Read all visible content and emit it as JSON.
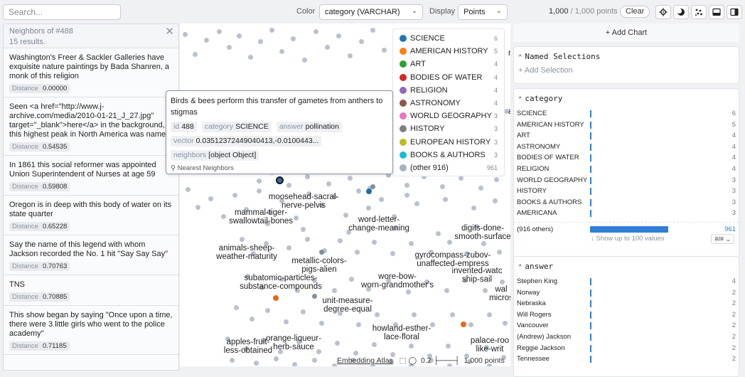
{
  "topbar": {
    "search_placeholder": "Search...",
    "color_label": "Color",
    "color_value": "category (VARCHAR)",
    "display_label": "Display",
    "display_value": "Points",
    "count_shown": "1,000",
    "count_total": "/ 1,000 points",
    "clear_label": "Clear",
    "icons": [
      "gear-icon",
      "moon-icon",
      "scatter-icon",
      "panel-bottom-icon",
      "panel-right-icon"
    ]
  },
  "neighbors": {
    "title": "Neighbors of #488",
    "results": "15 results.",
    "distance_label": "Distance",
    "items": [
      {
        "text": "Washington's Freer & Sackler Galleries have exquisite nature paintings by Bada Shanren, a monk of this religion",
        "distance": "0.00000"
      },
      {
        "text": "Seen <a href=\"http://www.j-archive.com/media/2010-01-21_J_27.jpg\" target=\"_blank\">here</a> in the background, this highest peak in North America was name...",
        "distance": "0.54535"
      },
      {
        "text": "In 1861 this social reformer was appointed Union Superintendent of Nurses at age 59",
        "distance": "0.59808"
      },
      {
        "text": "Oregon is in deep with this body of water on its state quarter",
        "distance": "0.65228"
      },
      {
        "text": "Say the name of this legend with whom Jackson recorded the No. 1 hit \"Say Say Say\"",
        "distance": "0.70763"
      },
      {
        "text": "TNS",
        "distance": "0.70885"
      },
      {
        "text": "This show began by saying \"Once upon a time, there were 3 little girls who went to the police academy\"",
        "distance": "0.71185"
      }
    ]
  },
  "map": {
    "cluster_labels": [
      "moosehead-sacral-\nnerve-pelvis",
      "mammal-tiger-\nswallowtail-bones",
      "word-letter-\nchange-meaning",
      "digits-done-\nsmooth-surface",
      "animals-sheep-\nweather-maturity",
      "metallic-colors-\npigs-alien",
      "gyrocompass-zubov-\nunaffected-empress",
      "invented-watc\nship-sail",
      "subatomic-particles-\nsubstance-compounds",
      "wore-bow-\nworn-grandmother's",
      "wal\nmicros",
      "unit-measure-\ndegree-equal",
      "howland-esther-\nlace-floral",
      "apples-fruit-\nless-obtained",
      "orange-liqueur-\nherb-sauce",
      "palace-roo\nlike-writ"
    ],
    "partial_labels": [
      "rab",
      "ap"
    ],
    "footer": {
      "link": "Embedding Atlas",
      "scale": "0.2",
      "points": "1,000 points"
    }
  },
  "legend": {
    "items": [
      {
        "label": "SCIENCE",
        "count": "6",
        "color": "#1f77b4"
      },
      {
        "label": "AMERICAN HISTORY",
        "count": "5",
        "color": "#ff7f0e"
      },
      {
        "label": "ART",
        "count": "4",
        "color": "#2ca02c"
      },
      {
        "label": "BODIES OF WATER",
        "count": "4",
        "color": "#d62728"
      },
      {
        "label": "RELIGION",
        "count": "4",
        "color": "#9467bd"
      },
      {
        "label": "ASTRONOMY",
        "count": "4",
        "color": "#8c564b"
      },
      {
        "label": "WORLD GEOGRAPHY",
        "count": "3",
        "color": "#e377c2"
      },
      {
        "label": "HISTORY",
        "count": "3",
        "color": "#7f7f7f"
      },
      {
        "label": "EUROPEAN HISTORY",
        "count": "3",
        "color": "#bcbd22"
      },
      {
        "label": "BOOKS & AUTHORS",
        "count": "3",
        "color": "#17becf"
      },
      {
        "label": "(other 916)",
        "count": "961",
        "color": "#a7b0c0"
      }
    ]
  },
  "tooltip": {
    "text": "Birds & bees perform this transfer of gametes from anthers to stigmas",
    "fields": {
      "id_key": "id",
      "id_val": "488",
      "category_key": "category",
      "category_val": "SCIENCE",
      "answer_key": "answer",
      "answer_val": "pollination",
      "vector_key": "vector",
      "vector_val": "0.03512372449040413,-0.0100443...",
      "neighbors_key": "neighbors",
      "neighbors_val": "[object Object]"
    },
    "nn_label": "Nearest Neighbors"
  },
  "right": {
    "add_chart": "+ Add Chart",
    "named_title": "Named Selections",
    "add_selection": "+ Add Selection",
    "category": {
      "title": "category",
      "rows": [
        {
          "label": "SCIENCE",
          "count": "6"
        },
        {
          "label": "AMERICAN HISTORY",
          "count": "5"
        },
        {
          "label": "ART",
          "count": "4"
        },
        {
          "label": "ASTRONOMY",
          "count": "4"
        },
        {
          "label": "BODIES OF WATER",
          "count": "4"
        },
        {
          "label": "RELIGION",
          "count": "4"
        },
        {
          "label": "WORLD GEOGRAPHY",
          "count": "3"
        },
        {
          "label": "HISTORY",
          "count": "3"
        },
        {
          "label": "BOOKS & AUTHORS",
          "count": "3"
        },
        {
          "label": "AMERICANA",
          "count": "3"
        }
      ],
      "others_label": "(916 others)",
      "others_count": "961",
      "show_more": "Show up to 100 values",
      "format": "#/#"
    },
    "answer": {
      "title": "answer",
      "rows": [
        {
          "label": "Stephen King",
          "count": "4"
        },
        {
          "label": "Norway",
          "count": "2"
        },
        {
          "label": "Nebraska",
          "count": "2"
        },
        {
          "label": "Will Rogers",
          "count": "2"
        },
        {
          "label": "Vancouver",
          "count": "2"
        },
        {
          "label": "(Andrew) Jackson",
          "count": "2"
        },
        {
          "label": "Reggie Jackson",
          "count": "2"
        },
        {
          "label": "Tennessee",
          "count": "2"
        }
      ]
    }
  }
}
